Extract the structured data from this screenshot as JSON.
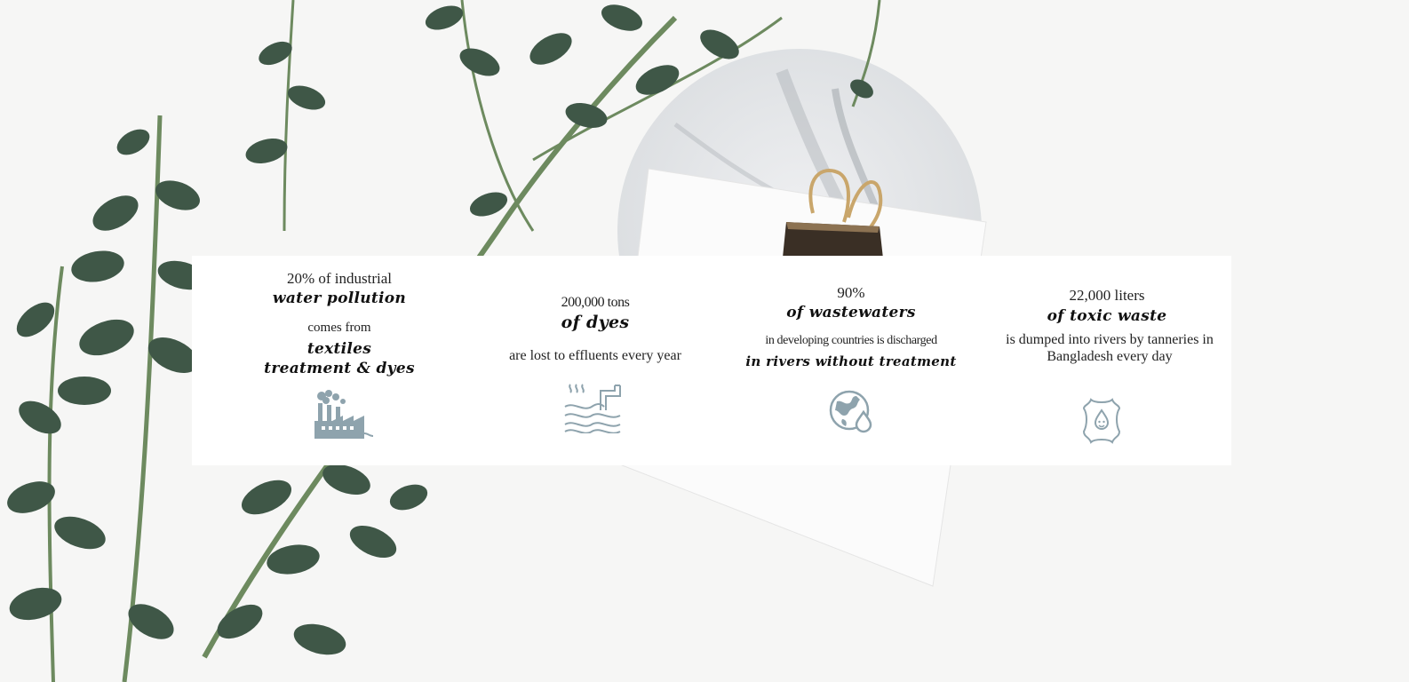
{
  "stats": [
    {
      "line1": "20% of industrial",
      "emph1": "water pollution",
      "line2": "comes from",
      "emph2": "textiles treatment & dyes",
      "icon": "factory-icon"
    },
    {
      "line1": "200,000 tons",
      "emph1": "of dyes",
      "line2": "are lost to effluents every year",
      "icon": "wastewater-pipe-icon"
    },
    {
      "line1": "90%",
      "emph1": "of wastewaters",
      "line2": "in developing countries is discharged",
      "emph2": "in rivers without treatment",
      "icon": "globe-drop-icon"
    },
    {
      "line1": "22,000 liters",
      "emph1": "of toxic waste",
      "line2": "is dumped into rivers by tanneries in Bangladesh every day",
      "icon": "leather-hide-icon"
    }
  ],
  "colors": {
    "icon": "#8ea3ad",
    "leaf": "#3f5747",
    "stem": "#6d8a5f",
    "marble": "#e4e6e8",
    "clip": "#3a2f25",
    "gold": "#c9a66b"
  }
}
